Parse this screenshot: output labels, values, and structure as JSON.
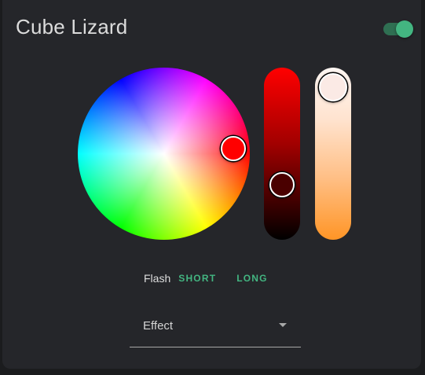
{
  "card": {
    "title": "Cube Lizard",
    "power_on": true
  },
  "color_picker": {
    "selected_color": "#ff0000",
    "brightness_value_color": "#4a0000",
    "white_value_color": "#fbeae5"
  },
  "flash": {
    "label": "Flash",
    "short_label": "SHORT",
    "long_label": "LONG"
  },
  "effect": {
    "label": "Effect"
  },
  "colors": {
    "card_bg": "#25262a",
    "accent": "#43b581"
  },
  "icons": {
    "dropdown": "caret-down-icon"
  }
}
